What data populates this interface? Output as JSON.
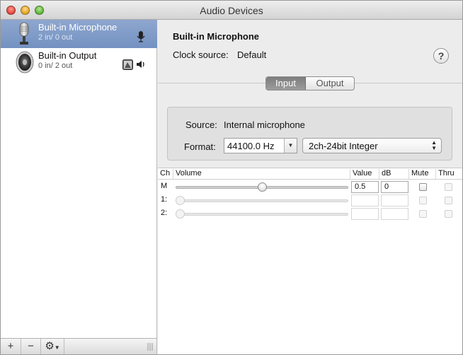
{
  "window": {
    "title": "Audio Devices"
  },
  "devices": [
    {
      "name": "Built-in Microphone",
      "io": "2 in/ 0 out",
      "selected": true,
      "icon": "microphone-icon"
    },
    {
      "name": "Built-in Output",
      "io": "0 in/ 2 out",
      "selected": false,
      "icon": "speaker-icon"
    }
  ],
  "sidebar_toolbar": {
    "add": "+",
    "remove": "−",
    "gear": "⚙"
  },
  "detail": {
    "device_title": "Built-in Microphone",
    "clock_label": "Clock source:",
    "clock_value": "Default",
    "help": "?",
    "tabs": [
      {
        "label": "Input",
        "selected": true
      },
      {
        "label": "Output",
        "selected": false
      }
    ],
    "source_label": "Source:",
    "source_value": "Internal microphone",
    "format_label": "Format:",
    "sample_rate": "44100.0 Hz",
    "bit_format": "2ch-24bit Integer"
  },
  "table": {
    "headers": {
      "ch": "Ch",
      "volume": "Volume",
      "value": "Value",
      "db": "dB",
      "mute": "Mute",
      "thru": "Thru"
    },
    "rows": [
      {
        "ch": "M",
        "volume": 0.5,
        "value": "0.5",
        "db": "0",
        "enabled": true
      },
      {
        "ch": "1:",
        "volume": 0,
        "value": "",
        "db": "",
        "enabled": false
      },
      {
        "ch": "2:",
        "volume": 0,
        "value": "",
        "db": "",
        "enabled": false
      }
    ]
  },
  "colors": {
    "selection": "#7b97c6",
    "segment_selected": "#8a8a8a"
  }
}
